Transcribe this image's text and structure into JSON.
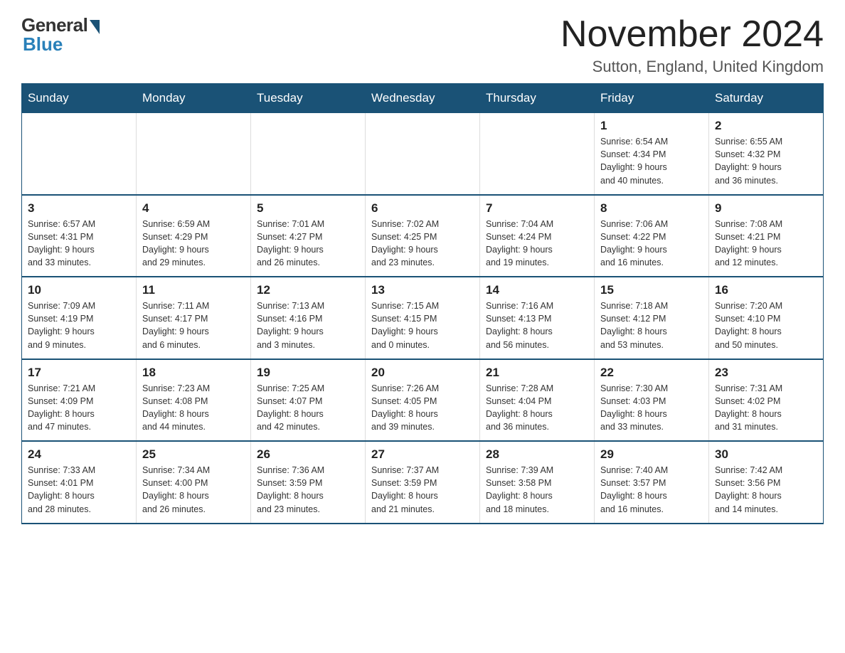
{
  "logo": {
    "general": "General",
    "blue": "Blue"
  },
  "header": {
    "title": "November 2024",
    "location": "Sutton, England, United Kingdom"
  },
  "weekdays": [
    "Sunday",
    "Monday",
    "Tuesday",
    "Wednesday",
    "Thursday",
    "Friday",
    "Saturday"
  ],
  "weeks": [
    [
      {
        "day": "",
        "info": ""
      },
      {
        "day": "",
        "info": ""
      },
      {
        "day": "",
        "info": ""
      },
      {
        "day": "",
        "info": ""
      },
      {
        "day": "",
        "info": ""
      },
      {
        "day": "1",
        "info": "Sunrise: 6:54 AM\nSunset: 4:34 PM\nDaylight: 9 hours\nand 40 minutes."
      },
      {
        "day": "2",
        "info": "Sunrise: 6:55 AM\nSunset: 4:32 PM\nDaylight: 9 hours\nand 36 minutes."
      }
    ],
    [
      {
        "day": "3",
        "info": "Sunrise: 6:57 AM\nSunset: 4:31 PM\nDaylight: 9 hours\nand 33 minutes."
      },
      {
        "day": "4",
        "info": "Sunrise: 6:59 AM\nSunset: 4:29 PM\nDaylight: 9 hours\nand 29 minutes."
      },
      {
        "day": "5",
        "info": "Sunrise: 7:01 AM\nSunset: 4:27 PM\nDaylight: 9 hours\nand 26 minutes."
      },
      {
        "day": "6",
        "info": "Sunrise: 7:02 AM\nSunset: 4:25 PM\nDaylight: 9 hours\nand 23 minutes."
      },
      {
        "day": "7",
        "info": "Sunrise: 7:04 AM\nSunset: 4:24 PM\nDaylight: 9 hours\nand 19 minutes."
      },
      {
        "day": "8",
        "info": "Sunrise: 7:06 AM\nSunset: 4:22 PM\nDaylight: 9 hours\nand 16 minutes."
      },
      {
        "day": "9",
        "info": "Sunrise: 7:08 AM\nSunset: 4:21 PM\nDaylight: 9 hours\nand 12 minutes."
      }
    ],
    [
      {
        "day": "10",
        "info": "Sunrise: 7:09 AM\nSunset: 4:19 PM\nDaylight: 9 hours\nand 9 minutes."
      },
      {
        "day": "11",
        "info": "Sunrise: 7:11 AM\nSunset: 4:17 PM\nDaylight: 9 hours\nand 6 minutes."
      },
      {
        "day": "12",
        "info": "Sunrise: 7:13 AM\nSunset: 4:16 PM\nDaylight: 9 hours\nand 3 minutes."
      },
      {
        "day": "13",
        "info": "Sunrise: 7:15 AM\nSunset: 4:15 PM\nDaylight: 9 hours\nand 0 minutes."
      },
      {
        "day": "14",
        "info": "Sunrise: 7:16 AM\nSunset: 4:13 PM\nDaylight: 8 hours\nand 56 minutes."
      },
      {
        "day": "15",
        "info": "Sunrise: 7:18 AM\nSunset: 4:12 PM\nDaylight: 8 hours\nand 53 minutes."
      },
      {
        "day": "16",
        "info": "Sunrise: 7:20 AM\nSunset: 4:10 PM\nDaylight: 8 hours\nand 50 minutes."
      }
    ],
    [
      {
        "day": "17",
        "info": "Sunrise: 7:21 AM\nSunset: 4:09 PM\nDaylight: 8 hours\nand 47 minutes."
      },
      {
        "day": "18",
        "info": "Sunrise: 7:23 AM\nSunset: 4:08 PM\nDaylight: 8 hours\nand 44 minutes."
      },
      {
        "day": "19",
        "info": "Sunrise: 7:25 AM\nSunset: 4:07 PM\nDaylight: 8 hours\nand 42 minutes."
      },
      {
        "day": "20",
        "info": "Sunrise: 7:26 AM\nSunset: 4:05 PM\nDaylight: 8 hours\nand 39 minutes."
      },
      {
        "day": "21",
        "info": "Sunrise: 7:28 AM\nSunset: 4:04 PM\nDaylight: 8 hours\nand 36 minutes."
      },
      {
        "day": "22",
        "info": "Sunrise: 7:30 AM\nSunset: 4:03 PM\nDaylight: 8 hours\nand 33 minutes."
      },
      {
        "day": "23",
        "info": "Sunrise: 7:31 AM\nSunset: 4:02 PM\nDaylight: 8 hours\nand 31 minutes."
      }
    ],
    [
      {
        "day": "24",
        "info": "Sunrise: 7:33 AM\nSunset: 4:01 PM\nDaylight: 8 hours\nand 28 minutes."
      },
      {
        "day": "25",
        "info": "Sunrise: 7:34 AM\nSunset: 4:00 PM\nDaylight: 8 hours\nand 26 minutes."
      },
      {
        "day": "26",
        "info": "Sunrise: 7:36 AM\nSunset: 3:59 PM\nDaylight: 8 hours\nand 23 minutes."
      },
      {
        "day": "27",
        "info": "Sunrise: 7:37 AM\nSunset: 3:59 PM\nDaylight: 8 hours\nand 21 minutes."
      },
      {
        "day": "28",
        "info": "Sunrise: 7:39 AM\nSunset: 3:58 PM\nDaylight: 8 hours\nand 18 minutes."
      },
      {
        "day": "29",
        "info": "Sunrise: 7:40 AM\nSunset: 3:57 PM\nDaylight: 8 hours\nand 16 minutes."
      },
      {
        "day": "30",
        "info": "Sunrise: 7:42 AM\nSunset: 3:56 PM\nDaylight: 8 hours\nand 14 minutes."
      }
    ]
  ]
}
